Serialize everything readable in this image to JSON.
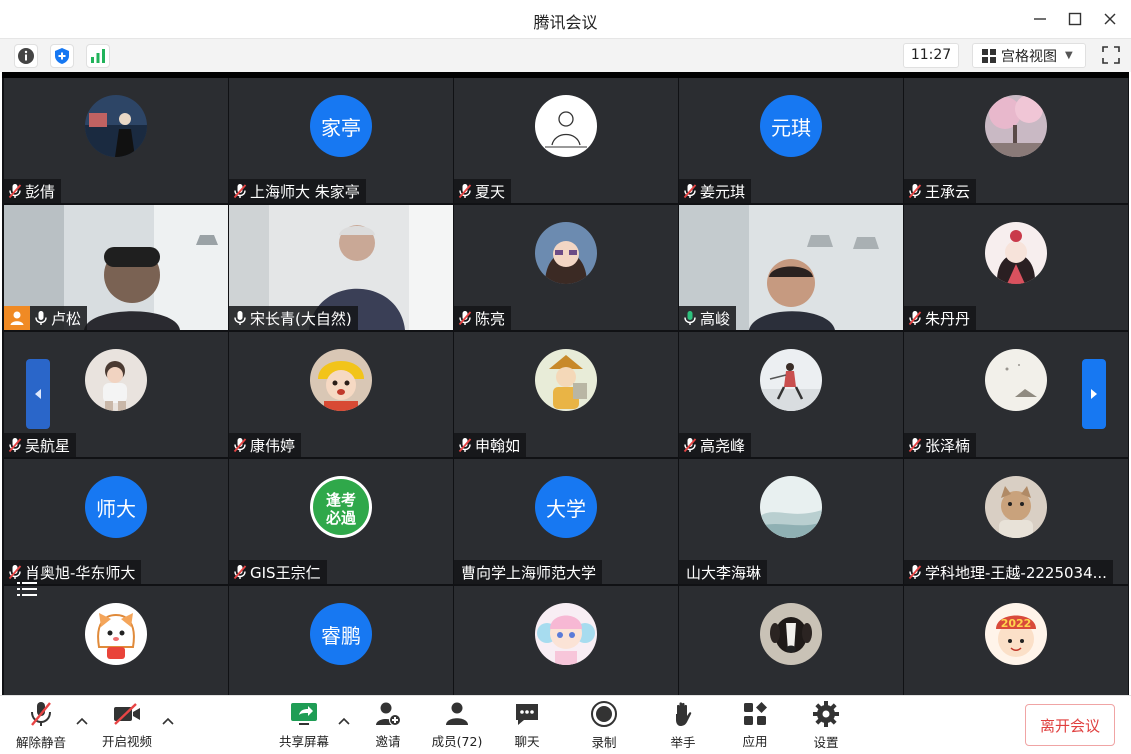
{
  "window": {
    "title": "腾讯会议"
  },
  "infobar": {
    "clock": "11:27",
    "view_label": "宫格视图"
  },
  "participants": [
    {
      "name": "彭倩",
      "avatar_text": ""
    },
    {
      "name": "上海师大 朱家亭",
      "avatar_text": "家亭"
    },
    {
      "name": "夏天",
      "avatar_text": ""
    },
    {
      "name": "姜元琪",
      "avatar_text": "元琪"
    },
    {
      "name": "王承云",
      "avatar_text": ""
    },
    {
      "name": "卢松",
      "avatar_text": ""
    },
    {
      "name": "宋长青(大自然)",
      "avatar_text": ""
    },
    {
      "name": "陈亮",
      "avatar_text": ""
    },
    {
      "name": "高峻",
      "avatar_text": ""
    },
    {
      "name": "朱丹丹",
      "avatar_text": ""
    },
    {
      "name": "吴航星",
      "avatar_text": ""
    },
    {
      "name": "康伟婷",
      "avatar_text": ""
    },
    {
      "name": "申翰如",
      "avatar_text": ""
    },
    {
      "name": "高尧峰",
      "avatar_text": ""
    },
    {
      "name": "张泽楠",
      "avatar_text": ""
    },
    {
      "name": "肖奥旭-华东师大",
      "avatar_text": "师大"
    },
    {
      "name": "GIS王宗仁",
      "avatar_text": ""
    },
    {
      "name": "曹向学上海师范大学",
      "avatar_text": "大学"
    },
    {
      "name": "山大李海琳",
      "avatar_text": ""
    },
    {
      "name": "学科地理-王越-2225034...",
      "avatar_text": ""
    },
    {
      "name": "",
      "avatar_text": ""
    },
    {
      "name": "",
      "avatar_text": "睿鹏"
    },
    {
      "name": "",
      "avatar_text": ""
    },
    {
      "name": "",
      "avatar_text": ""
    },
    {
      "name": "",
      "avatar_text": ""
    }
  ],
  "sticker_text": {
    "line1": "逢考",
    "line2": "必過"
  },
  "badge_2022": "2022",
  "toolbar": {
    "mute": "解除静音",
    "video": "开启视频",
    "share": "共享屏幕",
    "invite": "邀请",
    "members": "成员(72)",
    "chat": "聊天",
    "record": "录制",
    "raise_hand": "举手",
    "apps": "应用",
    "settings": "设置",
    "leave": "离开会议"
  },
  "colors": {
    "accent": "#1778f2",
    "leave": "#e0403f",
    "host": "#f08a24",
    "speaking": "#2ec27e"
  }
}
